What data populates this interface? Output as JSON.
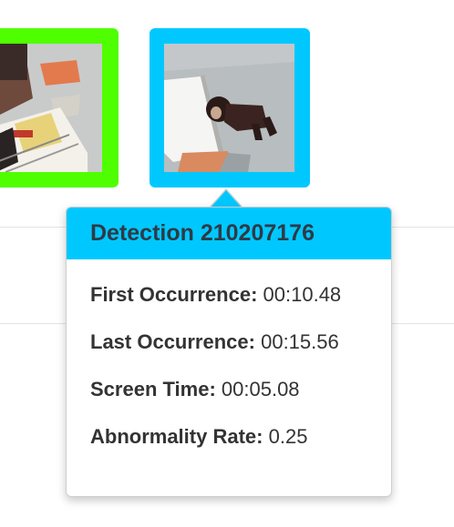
{
  "thumbnails": [
    {
      "name": "detection-thumbnail-green",
      "border_color": "#4fff00"
    },
    {
      "name": "detection-thumbnail-blue",
      "border_color": "#00c8ff",
      "selected": true
    }
  ],
  "popover": {
    "title": "Detection 210207176",
    "rows": [
      {
        "label": "First Occurrence:",
        "value": "00:10.48"
      },
      {
        "label": "Last Occurrence:",
        "value": "00:15.56"
      },
      {
        "label": "Screen Time:",
        "value": "00:05.08"
      },
      {
        "label": "Abnormality Rate:",
        "value": "0.25"
      }
    ]
  }
}
